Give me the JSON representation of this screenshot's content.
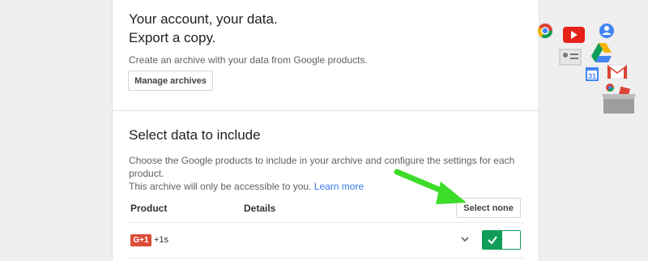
{
  "header": {
    "headline_line1": "Your account, your data.",
    "headline_line2": "Export a copy.",
    "description": "Create an archive with your data from Google products.",
    "manage_archives_label": "Manage archives"
  },
  "select_section": {
    "title": "Select data to include",
    "description_line1": "Choose the Google products to include in your archive and configure the settings for each product.",
    "description_line2": "This archive will only be accessible to you.",
    "learn_more_label": "Learn more",
    "select_none_label": "Select none",
    "columns": {
      "product": "Product",
      "details": "Details"
    }
  },
  "products": [
    {
      "badge": "G+1",
      "name": "+1s",
      "included": true
    }
  ],
  "colors": {
    "accent_green": "#0f9d58",
    "link_blue": "#3b78e7",
    "gplus_red": "#dd4b39",
    "arrow_green": "#3ddc2b"
  },
  "icons": [
    "chrome-icon",
    "youtube-icon",
    "profile-icon",
    "contacts-icon",
    "drive-icon",
    "calendar-icon",
    "gmail-icon",
    "archive-box-icon",
    "chevron-down-icon",
    "checkmark-icon",
    "green-arrow-icon"
  ]
}
